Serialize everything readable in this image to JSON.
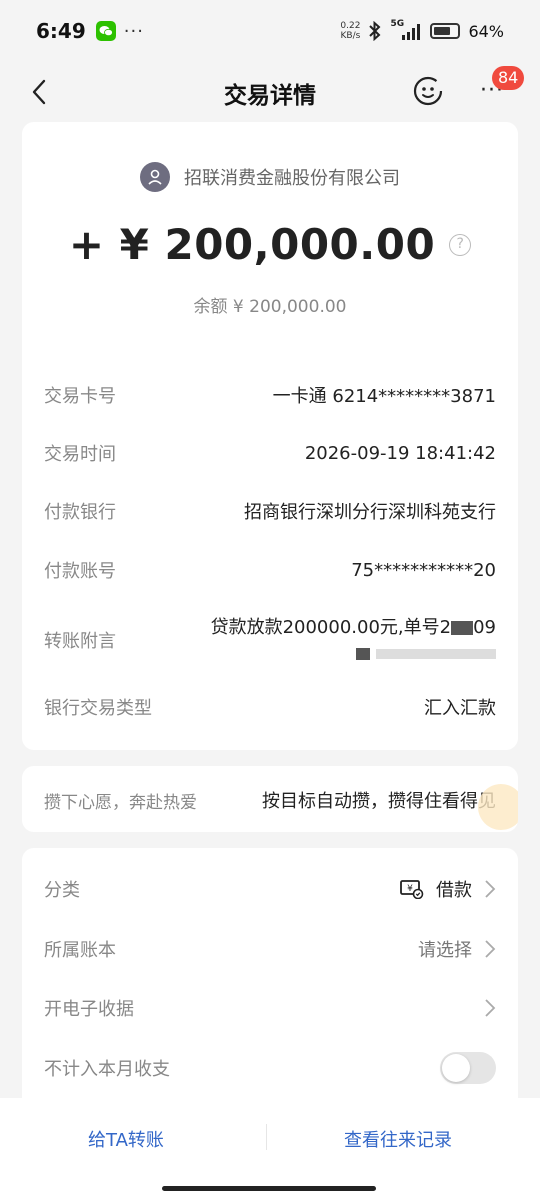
{
  "status_bar": {
    "time": "6:49",
    "dots": "···",
    "net_speed_value": "0.22",
    "net_speed_unit": "KB/s",
    "network": "5G",
    "battery": "64%"
  },
  "nav": {
    "title": "交易详情",
    "more": "···",
    "badge": "84"
  },
  "transaction": {
    "payer": "招联消费金融股份有限公司",
    "amount": "+ ¥ 200,000.00",
    "help": "?",
    "balance": "余额 ¥ 200,000.00"
  },
  "details": [
    {
      "label": "交易卡号",
      "value": "一卡通 6214********3871"
    },
    {
      "label": "交易时间",
      "value": "2026-09-19 18:41:42"
    },
    {
      "label": "付款银行",
      "value": "招商银行深圳分行深圳科苑支行"
    },
    {
      "label": "付款账号",
      "value": "75***********20"
    },
    {
      "label": "转账附言",
      "value": "贷款放款200000.00元,单号2",
      "value_tail": "09"
    },
    {
      "label": "银行交易类型",
      "value": "汇入汇款"
    }
  ],
  "promo": {
    "left": "攒下心愿，奔赴热爱",
    "right": "按目标自动攒，攒得住看得见"
  },
  "settings": {
    "category_label": "分类",
    "category_value": "借款",
    "ledger_label": "所属账本",
    "ledger_value": "请选择",
    "receipt_label": "开电子收据",
    "exclude_label": "不计入本月收支",
    "exclude_on": false
  },
  "bottom": {
    "transfer": "给TA转账",
    "history": "查看往来记录"
  }
}
